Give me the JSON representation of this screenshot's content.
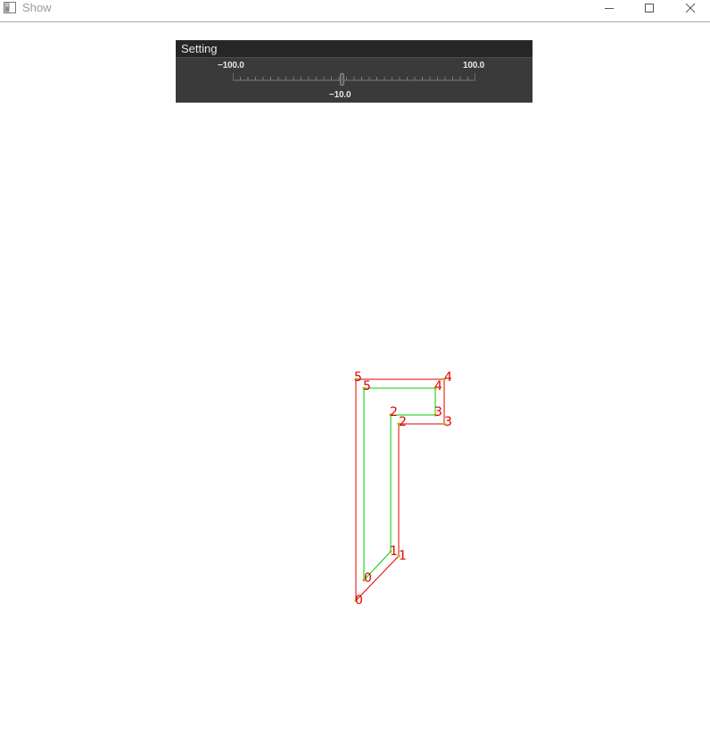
{
  "window": {
    "title": "Show",
    "icon": "app-window-icon",
    "controls": [
      "minimize-icon",
      "maximize-icon",
      "close-icon"
    ]
  },
  "setting_panel": {
    "title": "Setting",
    "slider": {
      "min_label": "−100.0",
      "max_label": "100.0",
      "value_label": "−10.0",
      "min": -100.0,
      "max": 100.0,
      "value": -10.0
    }
  },
  "shapes": {
    "colors": {
      "outer": "#e00000",
      "inner": "#00cc00",
      "label": "#e00000",
      "vertex": "#b8b800"
    },
    "outer_labels": [
      "0",
      "1",
      "2",
      "3",
      "4",
      "5"
    ],
    "inner_labels": [
      "0",
      "1",
      "2",
      "3",
      "4",
      "5"
    ]
  }
}
